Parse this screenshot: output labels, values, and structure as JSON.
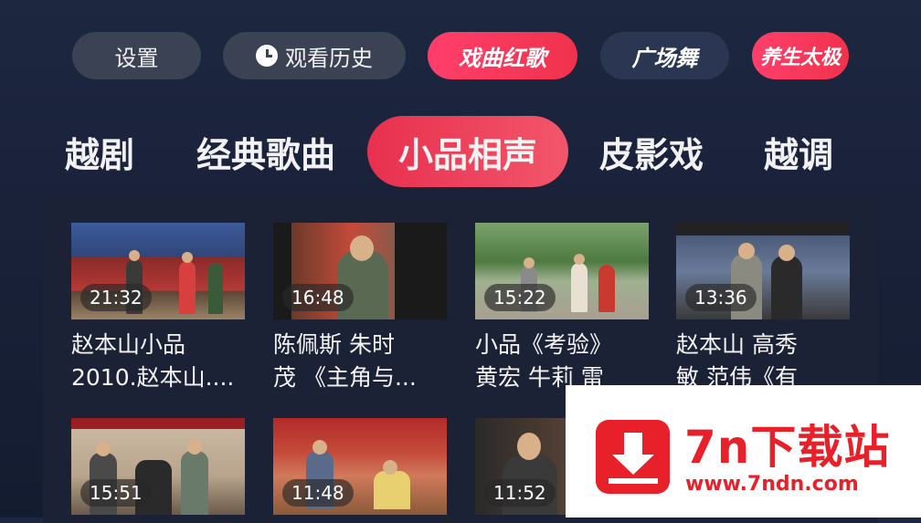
{
  "topbar": {
    "settings": "设置",
    "history": "观看历史",
    "opera_songs": "戏曲红歌",
    "square_dance": "广场舞",
    "taichi": "养生太极"
  },
  "tabs": [
    "越剧",
    "经典歌曲",
    "小品相声",
    "皮影戏",
    "越调"
  ],
  "active_tab": "小品相声",
  "videos": [
    {
      "duration": "21:32",
      "title_line1": "赵本山小品",
      "title_line2": "2010.赵本山...."
    },
    {
      "duration": "16:48",
      "title_line1": "陈佩斯 朱时",
      "title_line2": "茂 《主角与..."
    },
    {
      "duration": "15:22",
      "title_line1": "小品《考验》",
      "title_line2": "黄宏 牛莉 雷"
    },
    {
      "duration": "13:36",
      "title_line1": "赵本山 高秀",
      "title_line2": "敏 范伟《有"
    },
    {
      "duration": "15:51",
      "title_line1": "",
      "title_line2": ""
    },
    {
      "duration": "11:48",
      "title_line1": "",
      "title_line2": ""
    },
    {
      "duration": "11:52",
      "title_line1": "",
      "title_line2": ""
    }
  ],
  "watermark": {
    "name": "7n下载站",
    "url": "www.7ndn.com"
  },
  "colors": {
    "accent": "#f0324c",
    "background": "#1a223a",
    "pill_grey": "#3a4254",
    "watermark_red": "#e8202a"
  }
}
